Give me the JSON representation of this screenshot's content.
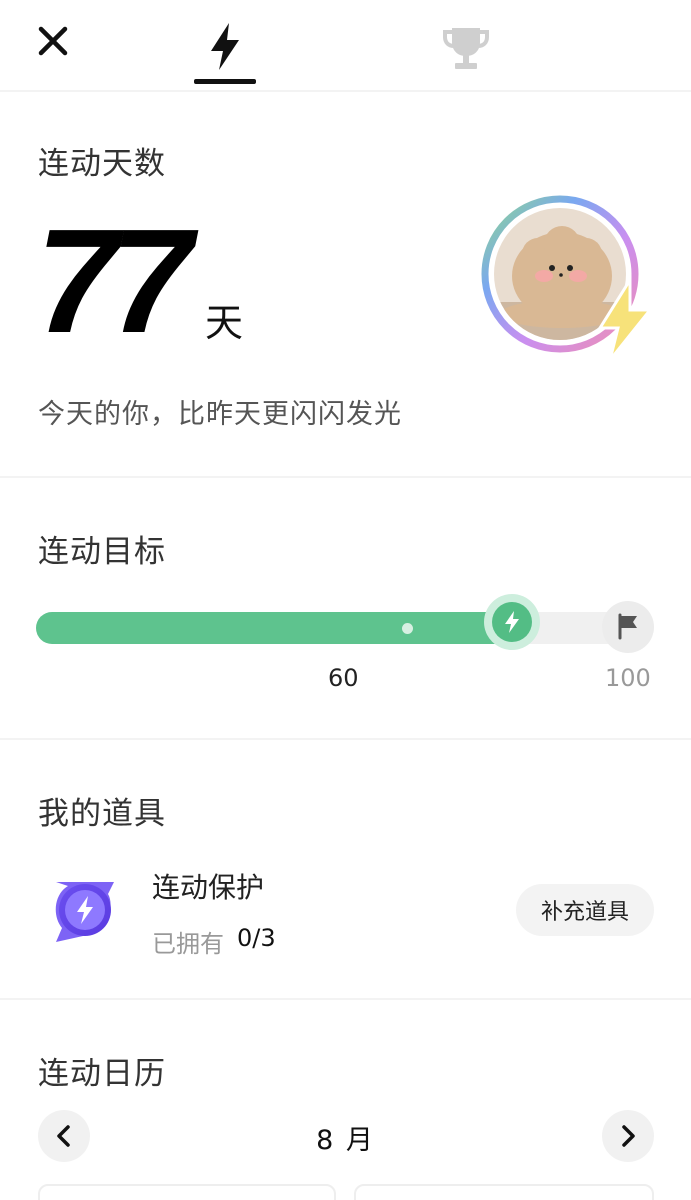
{
  "header": {
    "close_icon": "close-icon",
    "tabs": [
      {
        "name": "streak",
        "icon": "lightning-icon",
        "active": true
      },
      {
        "name": "trophy",
        "icon": "trophy-icon",
        "active": false
      }
    ]
  },
  "streak_days": {
    "title": "连动天数",
    "count": "77",
    "unit": "天",
    "motto": "今天的你，比昨天更闪闪发光"
  },
  "goal": {
    "title": "连动目标",
    "current": 77,
    "max": 100,
    "tick_label": "60",
    "end_label": "100",
    "colors": {
      "fill": "#5ec38e",
      "track": "#f0f0f0"
    }
  },
  "items": {
    "title": "我的道具",
    "list": [
      {
        "name": "连动保护",
        "owned_label": "已拥有",
        "owned_count": "0/3",
        "icon": "shield-lightning-icon"
      }
    ],
    "refill_label": "补充道具"
  },
  "calendar": {
    "title": "连动日历",
    "month": "8 月"
  }
}
